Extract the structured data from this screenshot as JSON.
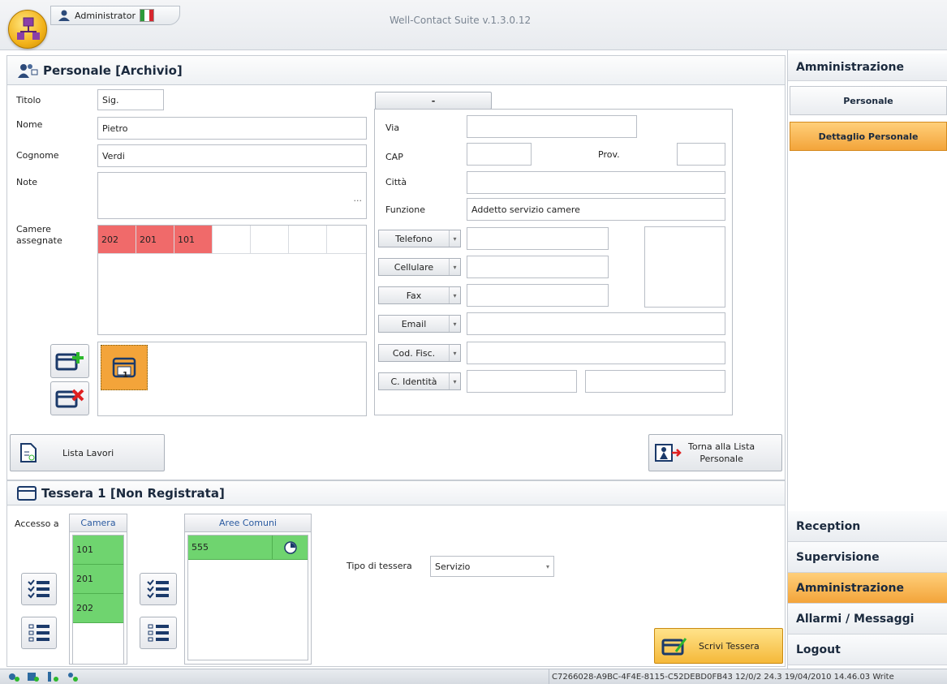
{
  "titlebar": {
    "user": "Administrator",
    "app_title": "Well-Contact Suite v.1.3.0.12",
    "flag_colors": [
      "#2e9a3b",
      "#ffffff",
      "#d7262e"
    ]
  },
  "personale": {
    "heading": "Personale [Archivio]",
    "titolo_label": "Titolo",
    "titolo_value": "Sig.",
    "nome_label": "Nome",
    "nome_value": "Pietro",
    "cognome_label": "Cognome",
    "cognome_value": "Verdi",
    "note_label": "Note",
    "note_dots": "...",
    "camere_label_1": "Camere",
    "camere_label_2": "assegnate",
    "camere": [
      "202",
      "201",
      "101",
      "",
      "",
      "",
      ""
    ],
    "card_number": "1",
    "tab_label": "-",
    "via_label": "Via",
    "cap_label": "CAP",
    "prov_label": "Prov.",
    "citta_label": "Città",
    "funzione_label": "Funzione",
    "funzione_value": "Addetto servizio camere",
    "phone_types": [
      "Telefono",
      "Cellulare",
      "Fax",
      "Email",
      "Cod. Fisc.",
      "C. Identità"
    ],
    "lista_lavori": "Lista Lavori",
    "torna_1": "Torna alla Lista",
    "torna_2": "Personale"
  },
  "tessera": {
    "heading": "Tessera 1 [Non Registrata]",
    "accesso_label": "Accesso a",
    "camera_header": "Camera",
    "camere": [
      "101",
      "201",
      "202"
    ],
    "aree_header": "Aree Comuni",
    "aree": [
      "555"
    ],
    "tipo_label": "Tipo di tessera",
    "tipo_value": "Servizio",
    "scrivi": "Scrivi Tessera"
  },
  "sidebar": {
    "top_heading": "Amministrazione",
    "items": [
      "Personale",
      "Dettaglio Personale"
    ],
    "bottom": [
      "Reception",
      "Supervisione",
      "Amministrazione",
      "Allarmi / Messaggi",
      "Logout"
    ]
  },
  "statusbar": {
    "text": "C7266028-A9BC-4F4E-8115-C52DEBD0FB43 12/0/2 24.3 19/04/2010 14.46.03 Write"
  },
  "colors": {
    "red": "#f06a6a",
    "green": "#6fd46f",
    "orange": "#f3a43a"
  }
}
